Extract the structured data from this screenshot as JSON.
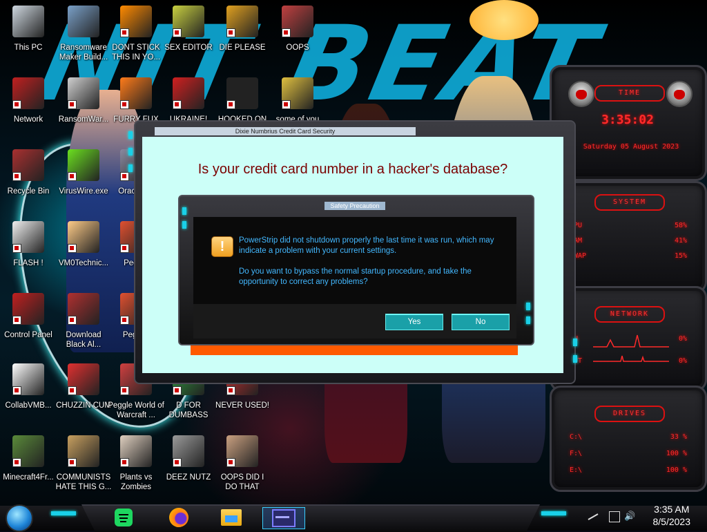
{
  "desktop": {
    "wallpaper_text": "NIT BEAT",
    "icons": [
      {
        "label": "This PC"
      },
      {
        "label": "Ransomware Maker Build..."
      },
      {
        "label": "DONT STICK THIS IN YO..."
      },
      {
        "label": "SEX EDITOR"
      },
      {
        "label": "DIE PLEASE"
      },
      {
        "label": "OOPS"
      },
      {
        "label": "Network"
      },
      {
        "label": "RansomWar..."
      },
      {
        "label": "FURRY FUX"
      },
      {
        "label": "UKRAINE!"
      },
      {
        "label": "HOOKED ON"
      },
      {
        "label": "some of you"
      },
      {
        "label": "Recycle Bin"
      },
      {
        "label": "VirusWire.exe"
      },
      {
        "label": "Orac Virtu"
      },
      {
        "label": "FLASH !"
      },
      {
        "label": "VM0Technic..."
      },
      {
        "label": "Peggle"
      },
      {
        "label": "Control Panel"
      },
      {
        "label": "Download Black Al..."
      },
      {
        "label": "Pegg D"
      },
      {
        "label": "CollabVMB..."
      },
      {
        "label": "CHUZZIN CUM"
      },
      {
        "label": "Peggle World of Warcraft ..."
      },
      {
        "label": "D FOR DUMBASS"
      },
      {
        "label": "NEVER USED!"
      },
      {
        "label": "Minecraft4Fr..."
      },
      {
        "label": "COMMUNISTS HATE THIS G..."
      },
      {
        "label": "Plants vs Zombies"
      },
      {
        "label": "DEEZ NUTZ"
      },
      {
        "label": "OOPS DID I DO THAT"
      }
    ]
  },
  "widgets": {
    "time": {
      "title": "TIME",
      "clock": "3:35:02",
      "date": "Saturday 05 August 2023"
    },
    "system": {
      "title": "SYSTEM",
      "rows": [
        {
          "label": "CPU",
          "value": "58%"
        },
        {
          "label": "RAM",
          "value": "41%"
        },
        {
          "label": "SWAP",
          "value": "15%"
        }
      ]
    },
    "network": {
      "title": "NETWORK",
      "rows": [
        {
          "label": "IN",
          "value": "0%"
        },
        {
          "label": "OUT",
          "value": "0%"
        }
      ]
    },
    "drives": {
      "title": "DRIVES",
      "rows": [
        {
          "label": "C:\\",
          "value": "33 %"
        },
        {
          "label": "F:\\",
          "value": "100 %"
        },
        {
          "label": "E:\\",
          "value": "100 %"
        }
      ]
    }
  },
  "dialog": {
    "title": "Dixie Numbrius Credit Card Security",
    "heading": "Is your credit card number in a hacker's database?",
    "inner_title": "Safety Precaution",
    "message_1": "PowerStrip did not shutdown properly the last time it was run, which may indicate a problem with your current settings.",
    "message_2": "Do you want to bypass the normal startup procedure, and take the opportunity to correct any problems?",
    "yes_label": "Yes",
    "no_label": "No",
    "warning_glyph": "!"
  },
  "taskbar": {
    "time": "3:35 AM",
    "date": "8/5/2023",
    "items": [
      "spotify-icon",
      "firefox-icon",
      "file-explorer-icon",
      "window-app-icon"
    ]
  },
  "colors": {
    "heading": "#7a0000",
    "message": "#43b8ff",
    "button": "#1aa0a8",
    "widget_red": "#ff2a2a",
    "dialog_bg": "#ccfff8",
    "orange_bar": "#ff5a00"
  }
}
